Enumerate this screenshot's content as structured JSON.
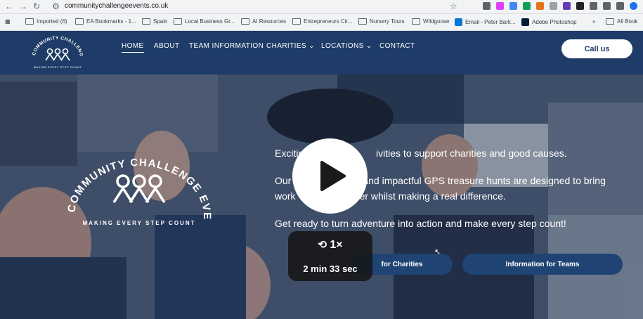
{
  "browser": {
    "url": "communitychallengeevents.co.uk",
    "bookmarks": [
      "Imported (6)",
      "EA Bookmarks - 1...",
      "Spain",
      "Local Business Gr...",
      "AI Resources",
      "Entrepreneurs Cir...",
      "Nursery Tours",
      "Wildgoose",
      "Email - Peter Bark...",
      "Adobe Photoshop",
      "All Book"
    ]
  },
  "site": {
    "logo_text": "COMMUNITY CHALLENGE EVENTS",
    "logo_tagline": "MAKING EVERY STEP COUNT",
    "nav": [
      "HOME",
      "ABOUT",
      "TEAM INFORMATION",
      "CHARITIES",
      "LOCATIONS",
      "CONTACT"
    ],
    "call_label": "Call us"
  },
  "hero": {
    "line1": "Exciting ... activities to support charities and good causes.",
    "line1_left": "Exciting",
    "line1_right": "ivities to support charities and good causes.",
    "line2_left": "Our",
    "line2_right": "and impactful GPS treasure hunts are designed to bring",
    "line3_left": "work",
    "line3_right": "er whilst making a real difference.",
    "line4": "Get ready to turn adventure into action and make every step count!",
    "cta_charities": "for Charities",
    "cta_teams": "Information for Teams"
  },
  "video": {
    "speed": "1×",
    "duration": "2 min 33 sec"
  },
  "colors": {
    "header_bg": "#1e3c67",
    "cta_bg": "#1f4473",
    "card_bg": "#141414"
  }
}
